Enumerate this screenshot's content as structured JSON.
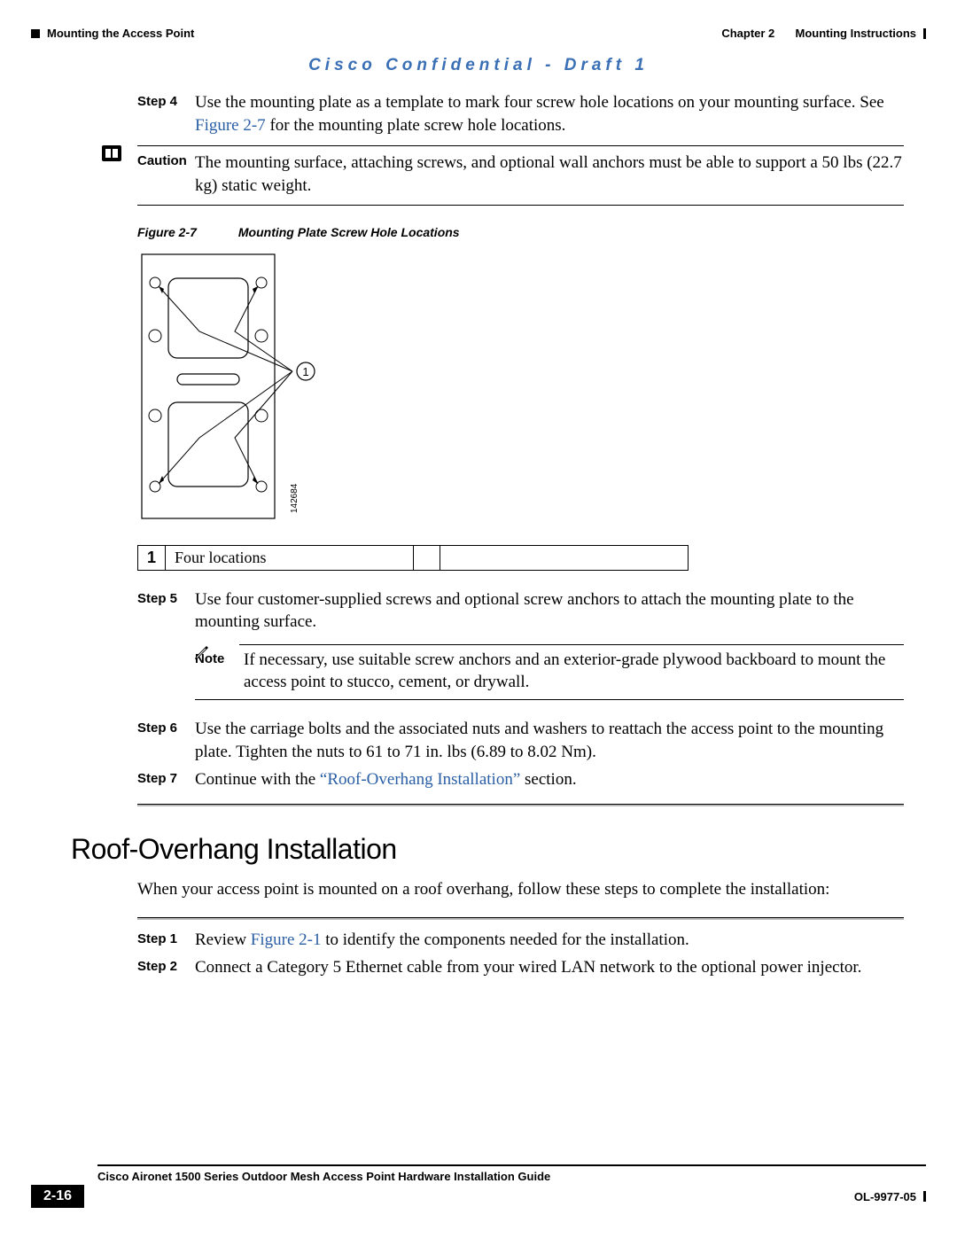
{
  "header": {
    "section_left": "Mounting the Access Point",
    "chapter_label": "Chapter 2",
    "chapter_title": "Mounting Instructions"
  },
  "banner": "Cisco Confidential - Draft 1",
  "steps_a": {
    "step4": {
      "label": "Step 4",
      "text_a": "Use the mounting plate as a template to mark four screw hole locations on your mounting surface. See ",
      "link": "Figure 2-7",
      "text_b": " for the mounting plate screw hole locations."
    },
    "caution": {
      "label": "Caution",
      "text": "The mounting surface, attaching screws, and optional wall anchors must be able to support a 50 lbs (22.7 kg) static weight."
    }
  },
  "figure": {
    "ref": "Figure 2-7",
    "title": "Mounting Plate Screw Hole Locations",
    "callout_1_num": "1",
    "callout_1_label": "Four locations",
    "diagram_num": "142684"
  },
  "steps_b": {
    "step5": {
      "label": "Step 5",
      "text": "Use four customer-supplied screws and optional screw anchors to attach the mounting plate to the mounting surface."
    },
    "note": {
      "label": "Note",
      "text": "If necessary, use suitable screw anchors and an exterior-grade plywood backboard to mount the access point to stucco, cement, or drywall."
    },
    "step6": {
      "label": "Step 6",
      "text": "Use the carriage bolts and the associated nuts and washers to reattach the access point to the mounting plate. Tighten the nuts to 61 to 71 in. lbs (6.89 to 8.02 Nm)."
    },
    "step7": {
      "label": "Step 7",
      "text_a": "Continue with the ",
      "link": "“Roof-Overhang Installation”",
      "text_b": " section."
    }
  },
  "section2": {
    "heading": "Roof-Overhang Installation",
    "intro": "When your access point is mounted on a roof overhang, follow these steps to complete the installation:",
    "step1": {
      "label": "Step 1",
      "text_a": "Review ",
      "link": "Figure 2-1",
      "text_b": " to identify the components needed for the installation."
    },
    "step2": {
      "label": "Step 2",
      "text": "Connect a Category 5 Ethernet cable from your wired LAN network to the optional power injector."
    }
  },
  "footer": {
    "doc_title": "Cisco Aironet 1500 Series Outdoor Mesh Access Point Hardware Installation Guide",
    "page": "2-16",
    "part": "OL-9977-05"
  }
}
